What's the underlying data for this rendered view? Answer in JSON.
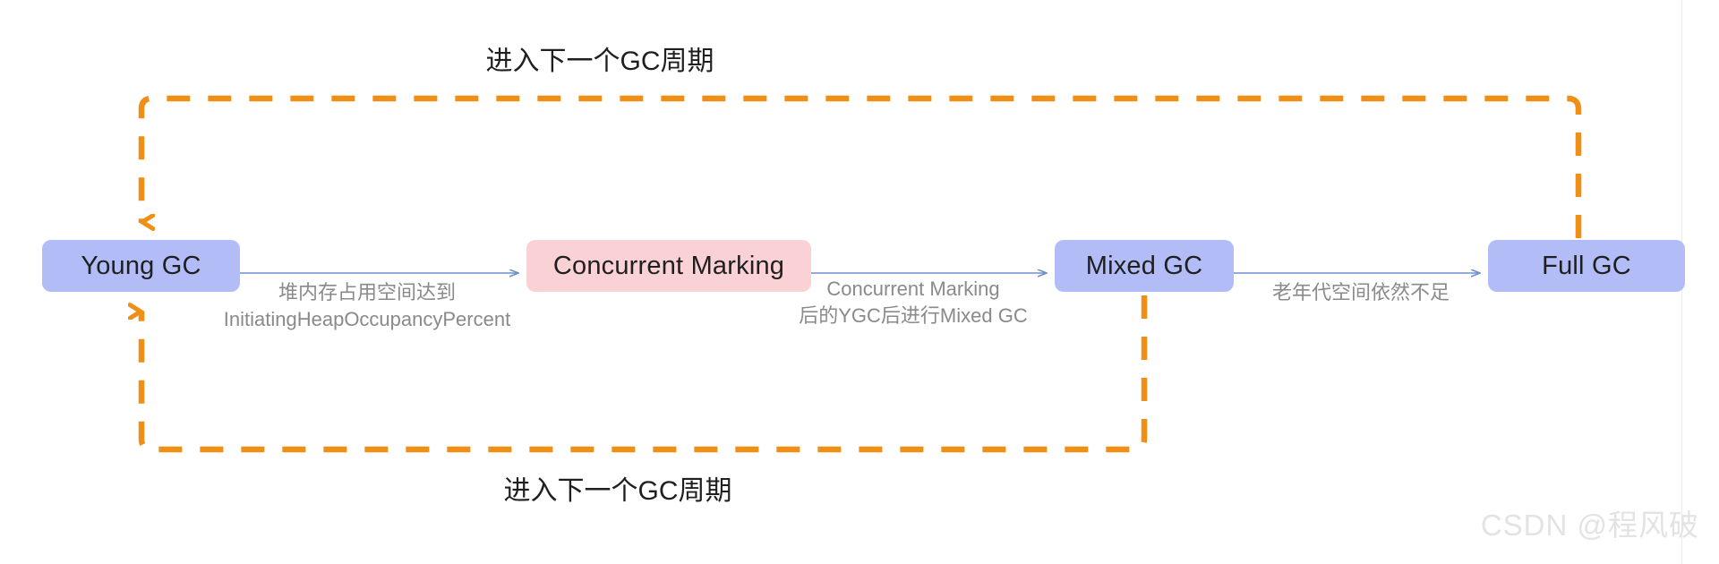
{
  "diagram": {
    "title": "G1 GC cycle flow",
    "colors": {
      "node_blue": "#b2bdf7",
      "node_pink": "#fad1d5",
      "solid_arrow": "#6f8fd0",
      "dashed_loop": "#ef8f16",
      "edge_label_text": "#8a8a8a",
      "loop_label_text": "#1f1f1f",
      "watermark": "#e3e3e3",
      "background": "#ffffff"
    },
    "nodes": [
      {
        "id": "young",
        "label": "Young GC",
        "style": "blue"
      },
      {
        "id": "concur",
        "label": "Concurrent Marking",
        "style": "pink"
      },
      {
        "id": "mixed",
        "label": "Mixed GC",
        "style": "blue"
      },
      {
        "id": "full",
        "label": "Full GC",
        "style": "blue"
      }
    ],
    "edges": [
      {
        "id": "edge-young-concur",
        "from": "young",
        "to": "concur",
        "label_line1": "堆内存占用空间达到",
        "label_line2": "InitiatingHeapOccupancyPercent"
      },
      {
        "id": "edge-concur-mixed",
        "from": "concur",
        "to": "mixed",
        "label_line1": "Concurrent Marking",
        "label_line2": "后的YGC后进行Mixed GC"
      },
      {
        "id": "edge-mixed-full",
        "from": "mixed",
        "to": "full",
        "label_line1": "老年代空间依然不足",
        "label_line2": ""
      }
    ],
    "loops": [
      {
        "id": "loop-top",
        "label": "进入下一个GC周期",
        "from": "full",
        "to": "young"
      },
      {
        "id": "loop-bottom",
        "label": "进入下一个GC周期",
        "from": "mixed",
        "to": "young"
      }
    ],
    "watermark": "CSDN @程风破"
  }
}
